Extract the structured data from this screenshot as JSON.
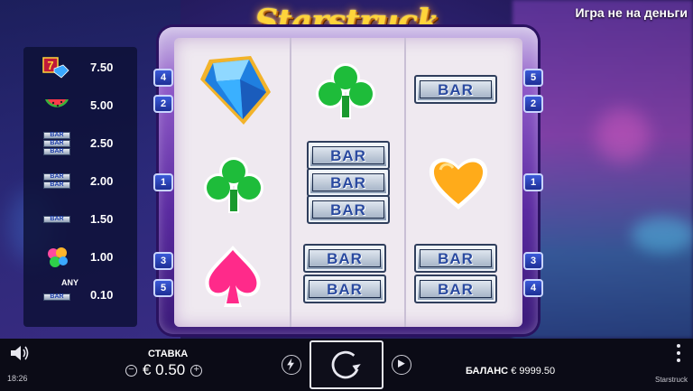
{
  "header": {
    "game_title": "Starstruck",
    "demo_label": "Игра не на деньги"
  },
  "paytable": {
    "rows": [
      {
        "symbol": "seven-and-diamond",
        "value": "7.50"
      },
      {
        "symbol": "watermelon",
        "value": "5.00"
      },
      {
        "symbol": "triple-bar",
        "value": "2.50"
      },
      {
        "symbol": "double-bar",
        "value": "2.00"
      },
      {
        "symbol": "single-bar",
        "value": "1.50"
      },
      {
        "symbol": "card-suits",
        "value": "1.00"
      },
      {
        "symbol": "any-bar",
        "value": "0.10",
        "prefix": "ANY"
      }
    ],
    "bar_text": "BAR"
  },
  "reels": {
    "left_line_tabs": [
      "4",
      "2",
      "1",
      "3",
      "5"
    ],
    "right_line_tabs": [
      "5",
      "2",
      "1",
      "3",
      "4"
    ],
    "bar_text": "BAR",
    "columns": [
      [
        "blue-diamond",
        "green-club",
        "pink-spade"
      ],
      [
        "green-club",
        "triple-bar",
        "double-bar"
      ],
      [
        "single-bar",
        "orange-heart",
        "double-bar"
      ]
    ]
  },
  "footer": {
    "time": "18:26",
    "bet_label": "СТАВКА",
    "bet_value": "€ 0.50",
    "balance_label": "БАЛАНС",
    "balance_value": "€ 9999.50",
    "brand": "Starstruck"
  },
  "colors": {
    "title": "#ffd43a",
    "frame": "#8f5ac8",
    "line_tab": "#2a45c0",
    "footer_bg": "#0b0b16"
  }
}
